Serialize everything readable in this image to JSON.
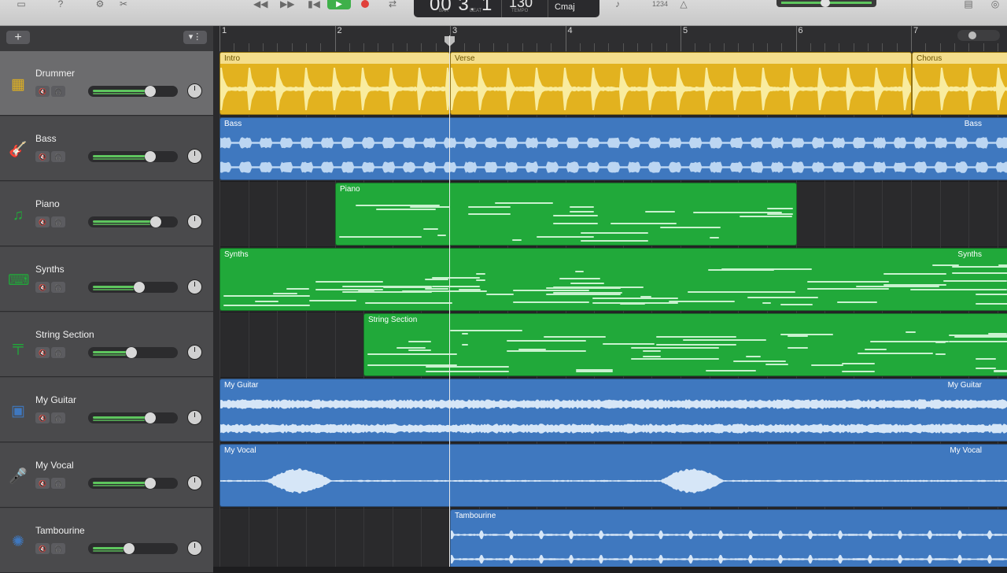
{
  "transport": {
    "position_display": "00 3. 1",
    "bar_label": "BAR",
    "beat_label": "BEAT",
    "tempo": "130",
    "tempo_label": "TEMPO",
    "key": "Cmaj",
    "counter": "1234"
  },
  "header_bar": {
    "add_label": "+",
    "filter_label": "⏚"
  },
  "ruler": {
    "bars": [
      "1",
      "2",
      "3",
      "4",
      "5",
      "6",
      "7"
    ]
  },
  "tracks": [
    {
      "name": "Drummer",
      "icon": "drum-machine-icon",
      "color": "#e2b21f",
      "volume": 0.72,
      "selected": true
    },
    {
      "name": "Bass",
      "icon": "bass-guitar-icon",
      "color": "#3f78bf",
      "volume": 0.72
    },
    {
      "name": "Piano",
      "icon": "piano-icon",
      "color": "#21a93a",
      "volume": 0.79
    },
    {
      "name": "Synths",
      "icon": "synth-keyboard-icon",
      "color": "#21a93a",
      "volume": 0.58
    },
    {
      "name": "String Section",
      "icon": "keyboard-stand-icon",
      "color": "#21a93a",
      "volume": 0.48
    },
    {
      "name": "My Guitar",
      "icon": "amp-icon",
      "color": "#3f78bf",
      "volume": 0.72
    },
    {
      "name": "My Vocal",
      "icon": "microphone-icon",
      "color": "#3f78bf",
      "volume": 0.72
    },
    {
      "name": "Tambourine",
      "icon": "tambourine-icon",
      "color": "#3f78bf",
      "volume": 0.45
    }
  ],
  "track_buttons": {
    "mute": "🔇",
    "solo": "🎧"
  },
  "regions": {
    "intro": "Intro",
    "verse": "Verse",
    "chorus": "Chorus",
    "bass": "Bass",
    "bass_right": "Bass",
    "piano": "Piano",
    "synths": "Synths",
    "synths_right": "Synths",
    "strings": "String Section",
    "guitar": "My Guitar",
    "guitar_right": "My Guitar",
    "vocal": "My Vocal",
    "vocal_right": "My Vocal",
    "tambourine": "Tambourine"
  },
  "colors": {
    "drummer": "#e2b21f",
    "audio": "#3f78bf",
    "midi": "#21a93a",
    "accent_green": "#5ec65e"
  }
}
